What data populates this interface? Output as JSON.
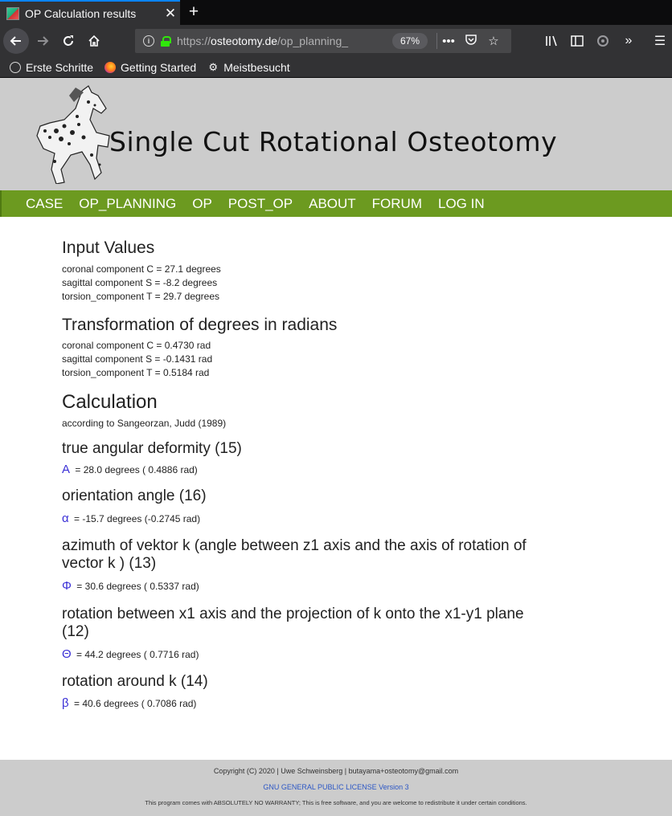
{
  "browser": {
    "tab_title": "OP Calculation results",
    "url_scheme": "https://",
    "url_domain": "osteotomy.de",
    "url_path": "/op_planning_",
    "zoom": "67%",
    "bookmarks": [
      {
        "label": "Erste Schritte",
        "icon": "globe-icon"
      },
      {
        "label": "Getting Started",
        "icon": "firefox-icon"
      },
      {
        "label": "Meistbesucht",
        "icon": "gear-icon"
      }
    ]
  },
  "site": {
    "title": "Single Cut Rotational Osteotomy",
    "nav": [
      "CASE",
      "OP_PLANNING",
      "OP",
      "POST_OP",
      "ABOUT",
      "FORUM",
      "LOG IN"
    ],
    "nav_color": "#6c9a20",
    "header_bg": "#cccccc"
  },
  "content": {
    "input_heading": "Input Values",
    "input_lines": [
      "coronal component C = 27.1 degrees",
      "sagittal component S = -8.2 degrees",
      "torsion_component T = 29.7 degrees"
    ],
    "transform_heading": "Transformation of degrees in radians",
    "transform_lines": [
      "coronal component C = 0.4730 rad",
      "sagittal component S = -0.1431 rad",
      "torsion_component T = 0.5184 rad"
    ],
    "calc_heading": "Calculation",
    "calc_note": "according to Sangeorzan, Judd (1989)",
    "results": [
      {
        "heading": "true angular deformity (15)",
        "symbol": "A",
        "value": " = 28.0 degrees ( 0.4886 rad)"
      },
      {
        "heading": "orientation angle (16)",
        "symbol": "α",
        "value": " = -15.7 degrees (-0.2745 rad)"
      },
      {
        "heading": "azimuth of vektor k (angle between z1 axis and the axis of rotation of vector k ) (13)",
        "symbol": "Φ",
        "value": " = 30.6 degrees ( 0.5337 rad)"
      },
      {
        "heading": "rotation between x1 axis and the projection of k onto the x1-y1 plane (12)",
        "symbol": "Θ",
        "value": " = 44.2 degrees ( 0.7716 rad)"
      },
      {
        "heading": "rotation around k (14)",
        "symbol": "β",
        "value": " = 40.6 degrees ( 0.7086 rad)"
      }
    ],
    "symbol_color": "#3a2fd6"
  },
  "footer": {
    "copyright": "Copyright (C) 2020 | Uwe Schweinsberg | butayama+osteotomy@gmail.com",
    "license": "GNU GENERAL PUBLIC LICENSE Version 3",
    "warranty": "This program comes with ABSOLUTELY NO WARRANTY; This is free software, and you are welcome to redistribute it under certain conditions."
  }
}
